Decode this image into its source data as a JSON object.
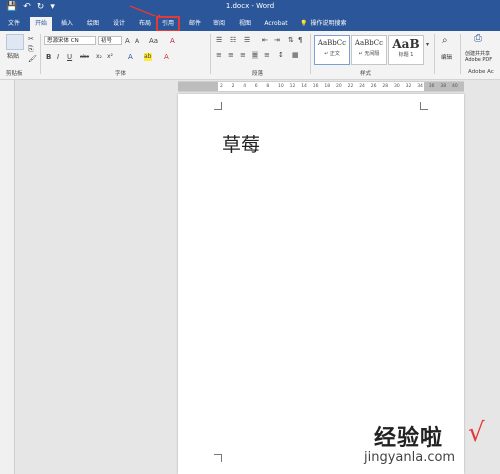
{
  "window": {
    "title": "1.docx - Word"
  },
  "qat": {
    "save": "💾",
    "undo": "↶",
    "redo": "↻",
    "more": "▾"
  },
  "tabs": [
    {
      "label": "文件"
    },
    {
      "label": "开始"
    },
    {
      "label": "插入"
    },
    {
      "label": "绘图"
    },
    {
      "label": "设计"
    },
    {
      "label": "布局"
    },
    {
      "label": "引用"
    },
    {
      "label": "邮件"
    },
    {
      "label": "审阅"
    },
    {
      "label": "视图"
    },
    {
      "label": "Acrobat"
    }
  ],
  "tellme": {
    "icon": "💡",
    "label": "操作说明搜索"
  },
  "ribbon": {
    "clipboard": {
      "paste_label": "粘贴",
      "group_label": "剪贴板"
    },
    "font": {
      "font_name": "思源宋体 CN",
      "font_size": "初号",
      "group_label": "字体",
      "bold": "B",
      "italic": "I",
      "underline": "U",
      "strike": "abc",
      "sub": "x₂",
      "sup": "x²",
      "grow": "A",
      "shrink": "A",
      "case": "Aa",
      "clear": "A",
      "font_color": "A",
      "highlight": "ab",
      "char_shading": "A"
    },
    "paragraph": {
      "group_label": "段落"
    },
    "styles": {
      "group_label": "样式",
      "items": [
        {
          "sample": "AaBbCc",
          "name": "↵ 正文"
        },
        {
          "sample": "AaBbCc",
          "name": "↵ 无间隔"
        },
        {
          "sample": "AaB",
          "name": "标题 1"
        }
      ]
    },
    "editing": {
      "label": "编辑"
    },
    "adobe": {
      "line1": "创建并共享",
      "line2": "Adobe PDF",
      "group_label": "Adobe Ac"
    }
  },
  "ruler": {
    "ticks": [
      "2",
      "2",
      "4",
      "6",
      "8",
      "10",
      "12",
      "14",
      "16",
      "18",
      "20",
      "22",
      "24",
      "26",
      "28",
      "30",
      "32",
      "34",
      "36",
      "38",
      "40"
    ]
  },
  "document": {
    "text": "草莓"
  },
  "watermark": {
    "title": "经验啦",
    "url": "jingyanla.com",
    "check": "√"
  }
}
